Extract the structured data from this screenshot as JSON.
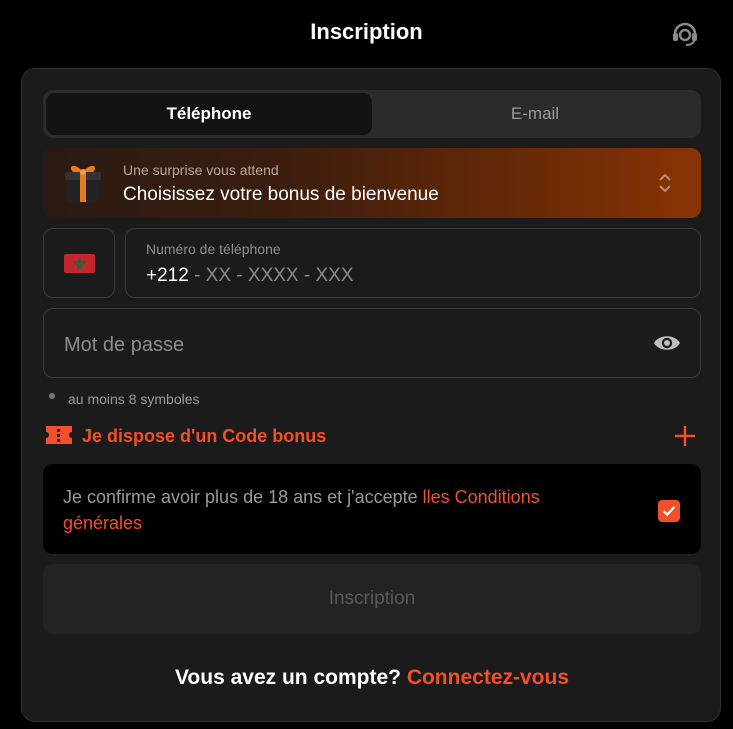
{
  "header": {
    "title": "Inscription",
    "support_icon": "headset-icon"
  },
  "tabs": [
    {
      "label": "Téléphone",
      "active": true
    },
    {
      "label": "E-mail",
      "active": false
    }
  ],
  "bonus": {
    "subtitle": "Une surprise vous attend",
    "title": "Choisissez votre bonus de bienvenue",
    "icon": "gift-icon"
  },
  "phone": {
    "country_flag": "morocco-flag-icon",
    "label": "Numéro de téléphone",
    "code": "+212",
    "mask": " - XX - XXXX - XXX"
  },
  "password": {
    "placeholder": "Mot de passe",
    "icon": "eye-icon"
  },
  "hint": "au moins 8 symboles",
  "promo": {
    "label": "Je dispose d'un Code bonus",
    "icon": "ticket-icon"
  },
  "terms": {
    "text": "Je confirme avoir plus de 18 ans et j'accepte ",
    "link": "lles Conditions générales",
    "checked": true
  },
  "submit_label": "Inscription",
  "footer": {
    "question": "Vous avez un compte? ",
    "link": "Connectez-vous"
  },
  "colors": {
    "accent": "#f24f2a",
    "card": "#1b1b1b",
    "background": "#000000"
  }
}
